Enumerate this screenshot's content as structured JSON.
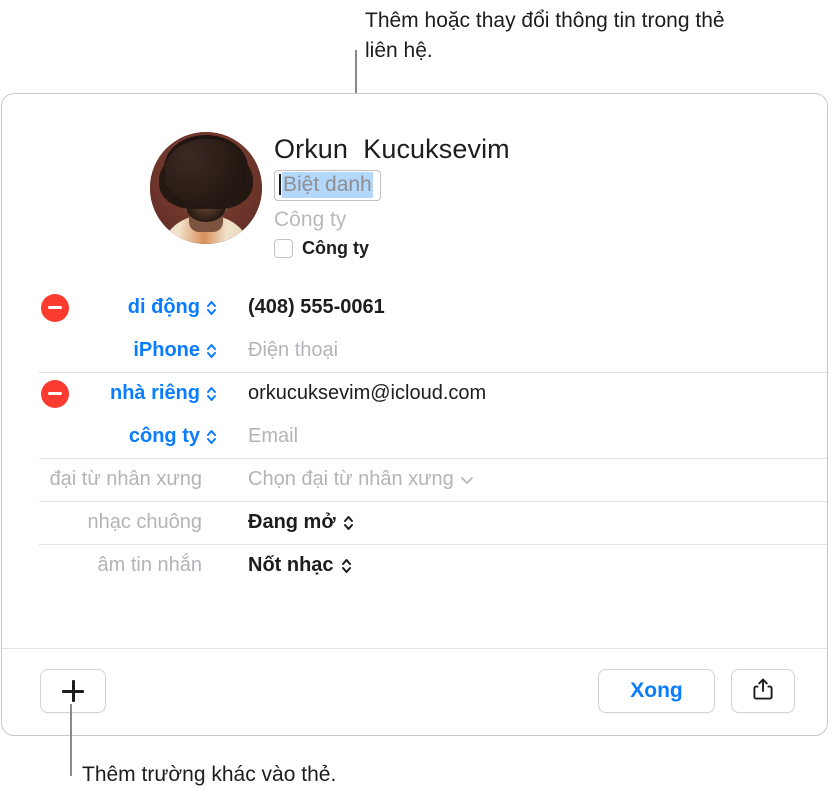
{
  "callouts": {
    "top": "Thêm hoặc thay đổi thông tin trong thẻ liên hệ.",
    "bottom": "Thêm trường khác vào thẻ."
  },
  "contact_card": {
    "avatar": {
      "icon": "contact-photo"
    },
    "full_name": "Orkun  Kucuksevim",
    "nickname_placeholder": "Biệt danh",
    "company_placeholder": "Công ty",
    "company_checkbox_label": "Công ty",
    "fields": [
      {
        "remove_icon": "minus-circle-icon",
        "label": "di động",
        "label_type": "stepper",
        "value": "(408) 555-0061",
        "value_style": "bold"
      },
      {
        "remove_icon": "",
        "label": "iPhone",
        "label_type": "stepper",
        "value": "Điện thoại",
        "value_style": "placeholder"
      },
      {
        "remove_icon": "minus-circle-icon",
        "label": "nhà riêng",
        "label_type": "stepper",
        "value": "orkucuksevim@icloud.com",
        "value_style": "normal"
      },
      {
        "remove_icon": "",
        "label": "công ty",
        "label_type": "stepper",
        "value": "Email",
        "value_style": "placeholder"
      },
      {
        "remove_icon": "",
        "label": "đại từ nhân xưng",
        "label_type": "plain",
        "value": "Chọn đại từ nhân xưng",
        "value_style": "muted",
        "value_icon": "chevron-down-icon"
      },
      {
        "remove_icon": "",
        "label": "nhạc chuông",
        "label_type": "plain",
        "value": "Đang mở",
        "value_style": "bold",
        "value_icon": "stepper-icon"
      },
      {
        "remove_icon": "",
        "label": "âm tin nhắn",
        "label_type": "plain",
        "value": "Nốt nhạc",
        "value_style": "bold",
        "value_icon": "stepper-icon"
      }
    ]
  },
  "footer": {
    "add_field_icon": "plus-icon",
    "done_label": "Xong",
    "share_icon": "share-icon"
  },
  "colors": {
    "accent_blue": "#0a7cff",
    "remove_red": "#fc3b30",
    "selection_blue": "#b4d8fb",
    "placeholder_gray": "#b4b4b8",
    "divider": "#e2e2e4"
  }
}
